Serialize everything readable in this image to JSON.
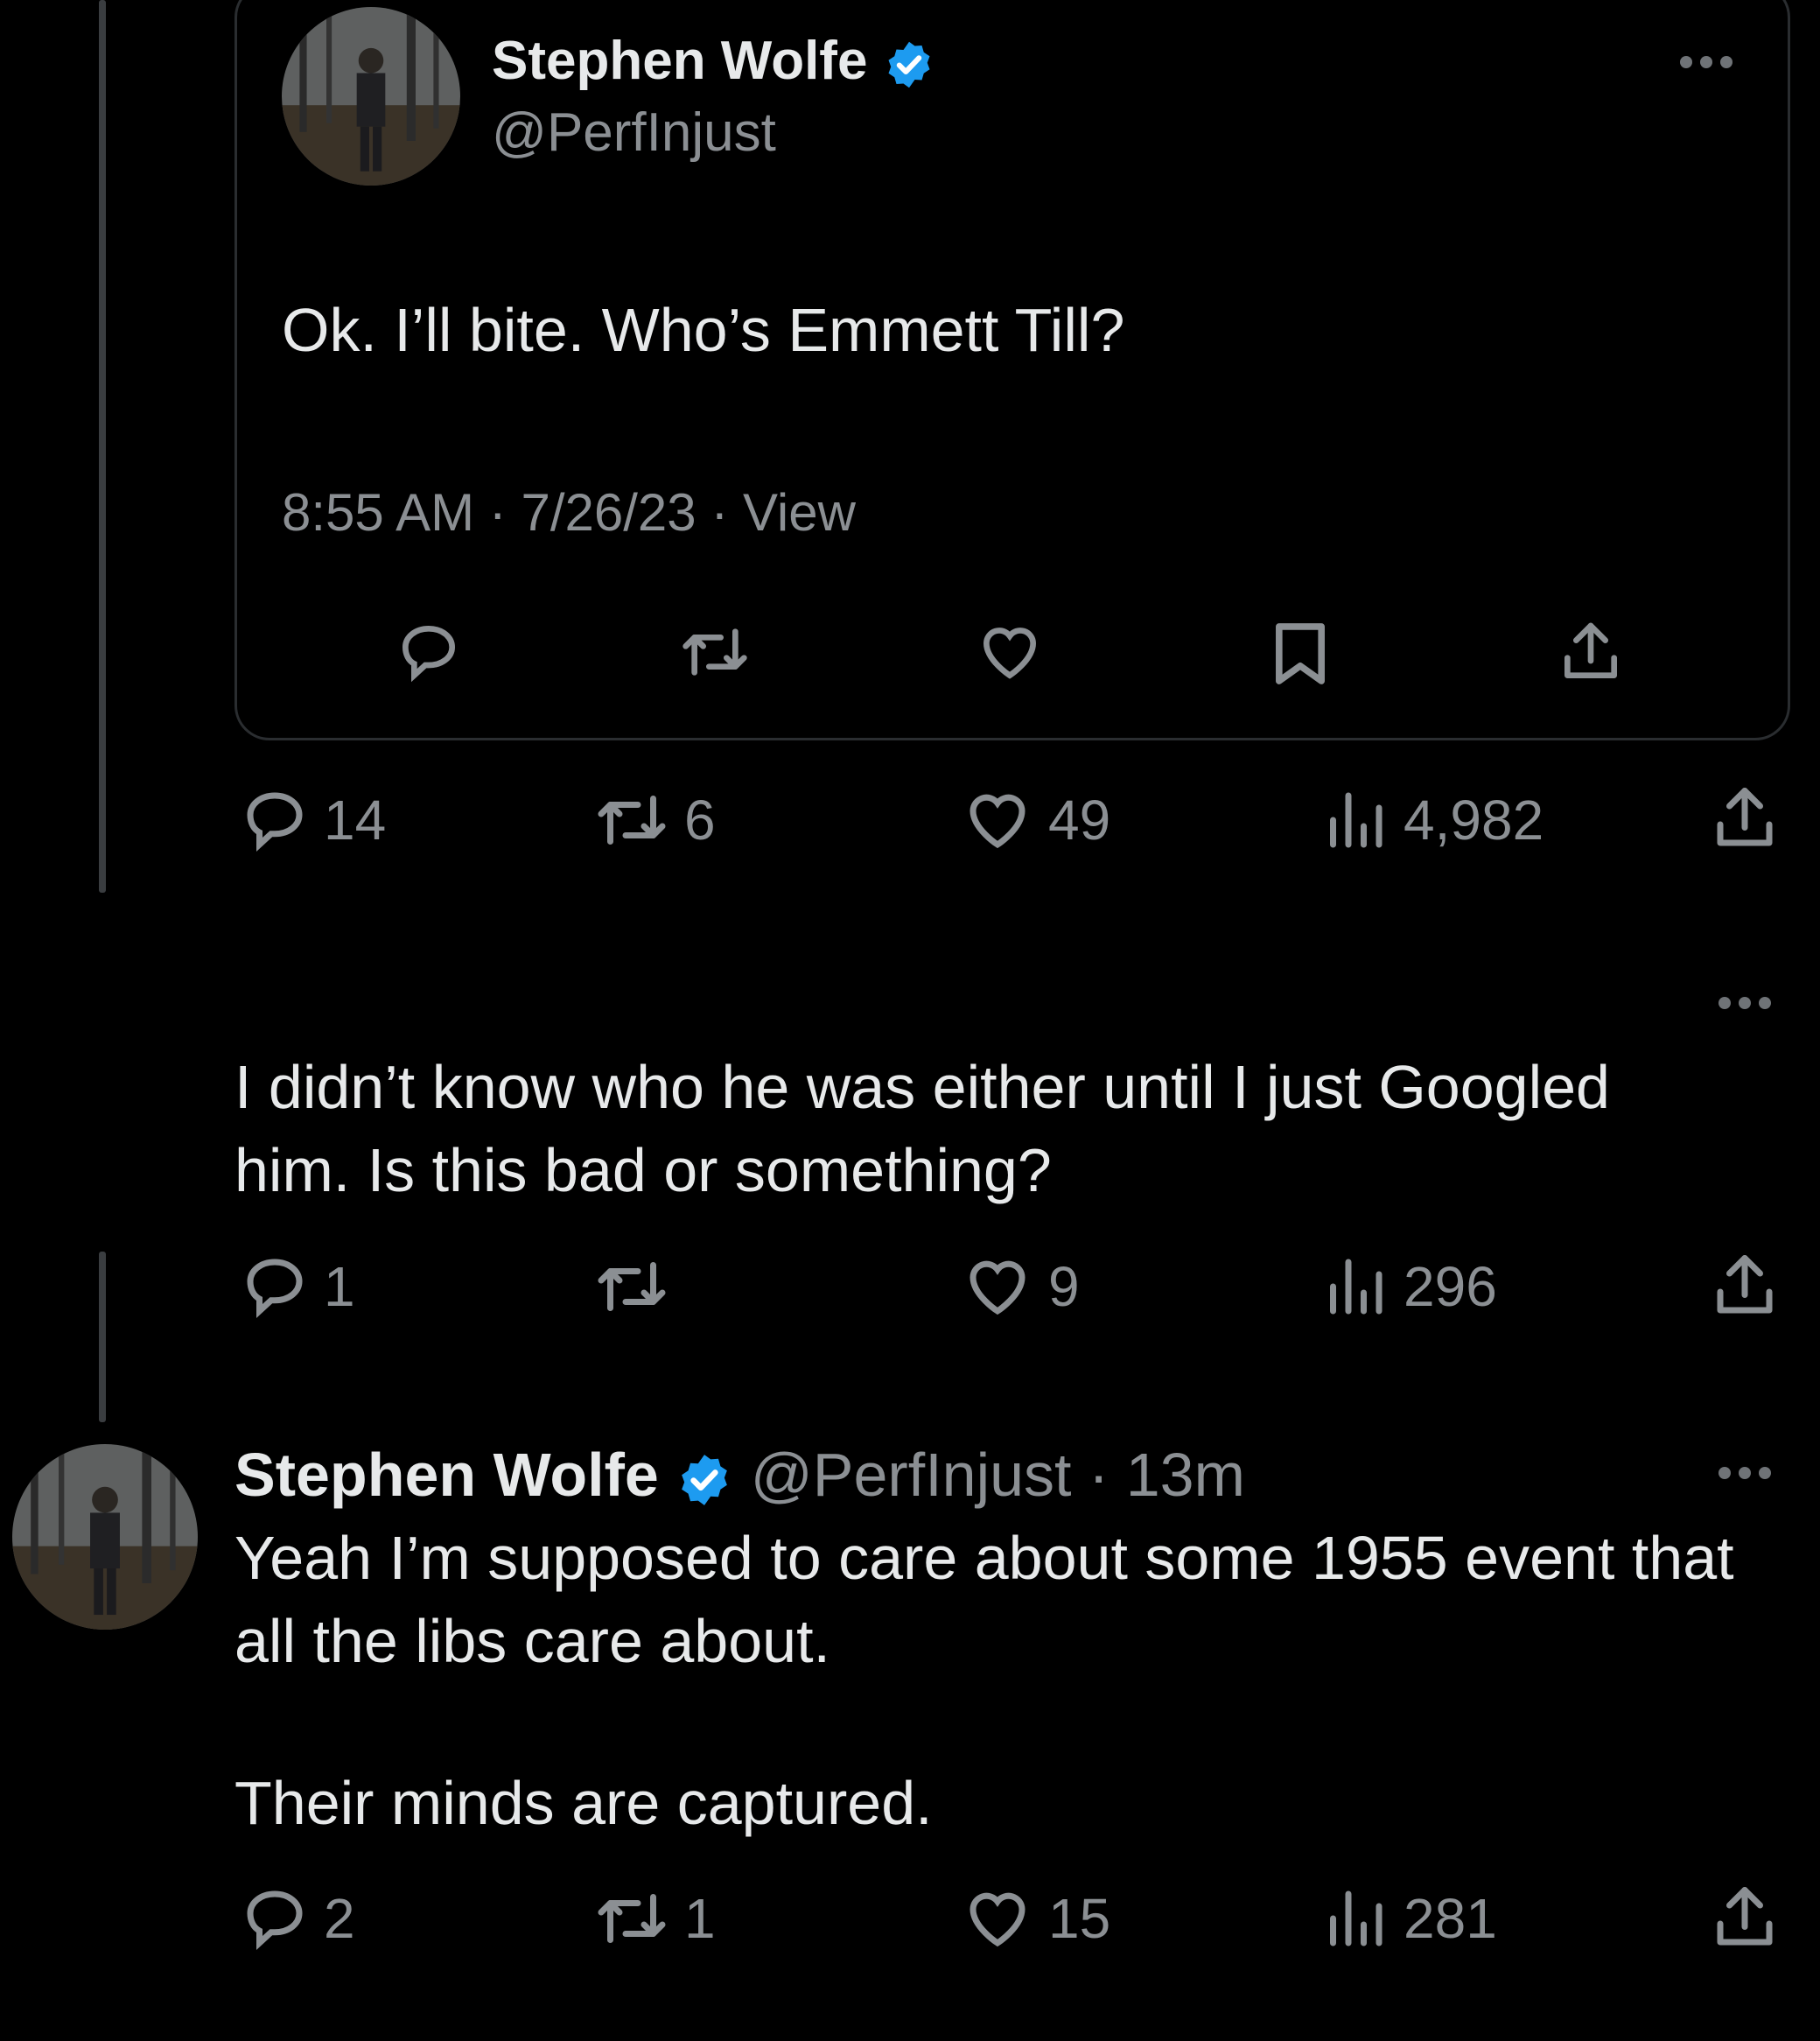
{
  "quoted_tweet": {
    "display_name": "Stephen Wolfe",
    "handle": "@PerfInjust",
    "text": "Ok. I’ll bite. Who’s Emmett Till?",
    "meta": "8:55 AM · 7/26/23 · View"
  },
  "quote_stats": {
    "replies": "14",
    "retweets": "6",
    "likes": "49",
    "views": "4,982"
  },
  "reply_tweet": {
    "text": "I didn’t know who he was either until I just Googled him. Is this bad or something?",
    "replies": "1",
    "retweets": "",
    "likes": "9",
    "views": "296"
  },
  "final_tweet": {
    "display_name": "Stephen Wolfe",
    "handle": "@PerfInjust",
    "time": "· 13m",
    "line1": "Yeah I’m supposed to care about some 1955 event that all the libs care about.",
    "line2": "Their minds are captured.",
    "replies": "2",
    "retweets": "1",
    "likes": "15",
    "views": "281"
  },
  "colors": {
    "background": "#000000",
    "text": "#e7e9ea",
    "muted": "#8b8f93",
    "verified": "#1d9bf0"
  }
}
